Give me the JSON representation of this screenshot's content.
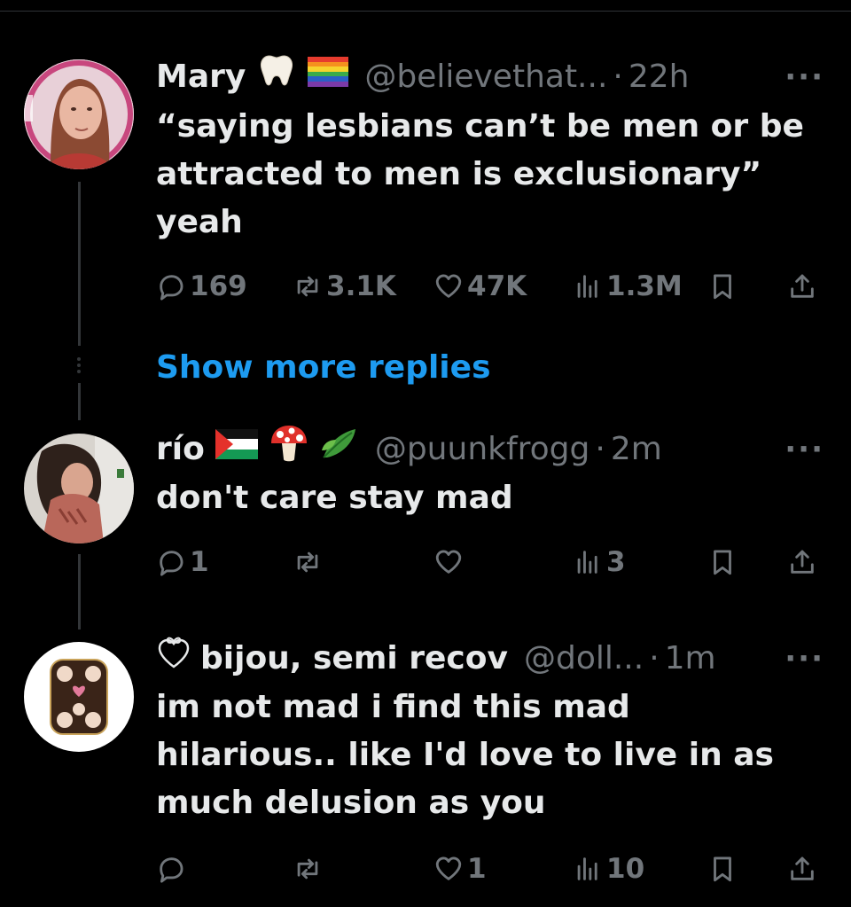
{
  "colors": {
    "background": "#000000",
    "text": "#e7e9ea",
    "muted": "#71767b",
    "link": "#1d9bf0"
  },
  "tweets": [
    {
      "name": "Mary",
      "emojis": [
        "tooth-emoji",
        "rainbow-flag-emoji"
      ],
      "handle": "@believethat...",
      "dot": "·",
      "time": "22h",
      "more": "···",
      "text": "“saying lesbians can’t be men or be attracted to men is exclusionary” yeah",
      "replies": "169",
      "reposts": "3.1K",
      "likes": "47K",
      "views": "1.3M"
    },
    {
      "name": "río",
      "emojis": [
        "palestine-flag-emoji",
        "mushroom-emoji",
        "leaves-emoji"
      ],
      "handle": "@puunkfrogg",
      "dot": "·",
      "time": "2m",
      "more": "···",
      "text": "don't care stay mad",
      "replies": "1",
      "reposts": "",
      "likes": "",
      "views": "3"
    },
    {
      "name": "bijou, semi recov",
      "emojis": [
        "ribbon-heart-emoji"
      ],
      "handle": "@doll...",
      "dot": "·",
      "time": "1m",
      "more": "···",
      "text": "im not mad i find this mad hilarious.. like I'd love to live in as much delusion as you",
      "replies": "",
      "reposts": "",
      "likes": "1",
      "views": "10"
    }
  ],
  "show_more": "Show more replies"
}
